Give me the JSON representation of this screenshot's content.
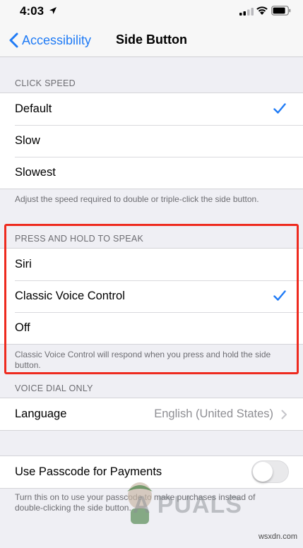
{
  "status_bar": {
    "time": "4:03"
  },
  "nav": {
    "back_label": "Accessibility",
    "title": "Side Button"
  },
  "click_speed": {
    "header": "CLICK SPEED",
    "options": [
      "Default",
      "Slow",
      "Slowest"
    ],
    "selected": "Default",
    "footer": "Adjust the speed required to double or triple-click the side button."
  },
  "press_hold": {
    "header": "PRESS AND HOLD TO SPEAK",
    "options": [
      "Siri",
      "Classic Voice Control",
      "Off"
    ],
    "selected": "Classic Voice Control",
    "footer": "Classic Voice Control will respond when you press and hold the side button."
  },
  "voice_dial": {
    "header": "VOICE DIAL ONLY",
    "language_label": "Language",
    "language_value": "English (United States)"
  },
  "payments": {
    "label": "Use Passcode for Payments",
    "enabled": false,
    "footer": "Turn this on to use your passcode to make purchases instead of double-clicking the side button."
  },
  "watermark": "A PUALS",
  "credit": "wsxdn.com",
  "colors": {
    "accent": "#1f7bf6",
    "highlight": "#ee2a1e"
  }
}
